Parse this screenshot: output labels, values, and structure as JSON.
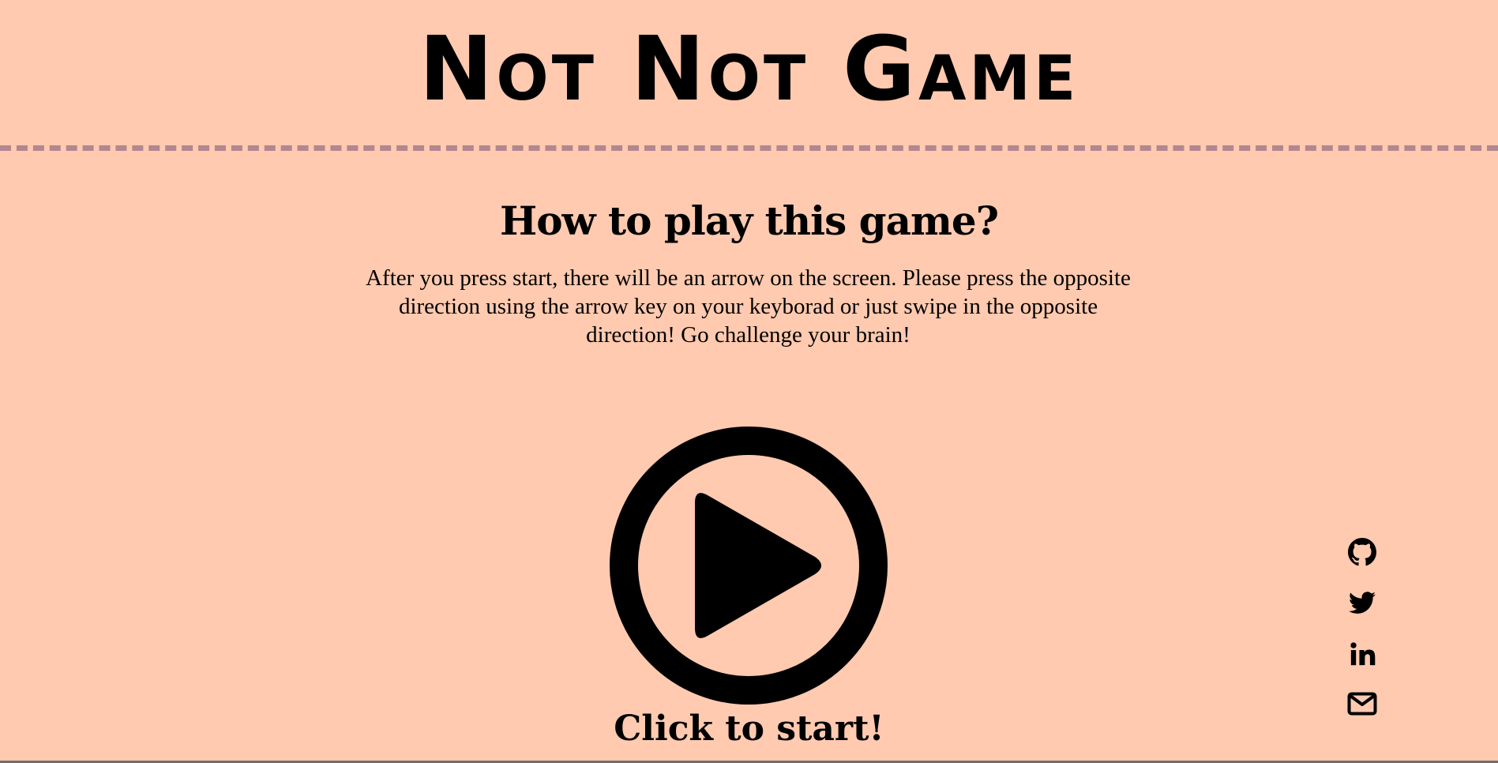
{
  "header": {
    "title": "Not Not Game"
  },
  "instructions": {
    "heading": "How to play this game?",
    "text": "After you press start, there will be an arrow on the screen. Please press the opposite direction using the arrow key on your keyborad or just swipe in the opposite direction! Go challenge your brain!"
  },
  "start": {
    "icon": "play-circle-icon",
    "label": "Click to start!"
  },
  "social": {
    "links": [
      {
        "icon": "github-icon"
      },
      {
        "icon": "twitter-icon"
      },
      {
        "icon": "linkedin-icon"
      },
      {
        "icon": "mail-icon"
      }
    ]
  },
  "colors": {
    "background": "#FFCAAF",
    "divider": "#B4868F",
    "text": "#000000"
  }
}
